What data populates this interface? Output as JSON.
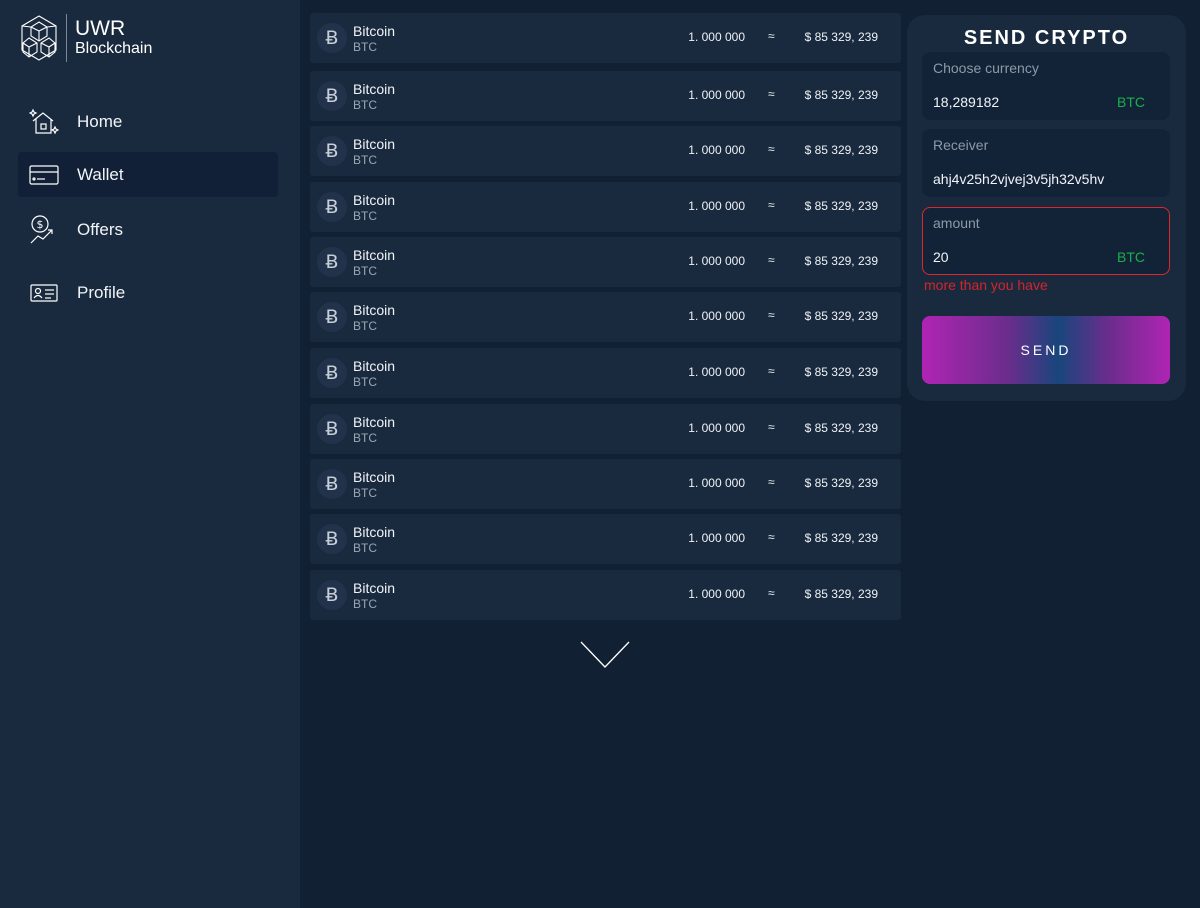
{
  "brand": {
    "line1": "UWR",
    "line2": "Blockchain"
  },
  "nav": [
    {
      "label": "Home",
      "icon": "home-icon",
      "active": false
    },
    {
      "label": "Wallet",
      "icon": "wallet-card-icon",
      "active": true
    },
    {
      "label": "Offers",
      "icon": "dollar-trend-icon",
      "active": false
    },
    {
      "label": "Profile",
      "icon": "id-card-icon",
      "active": false
    }
  ],
  "coins": [
    {
      "icon": "bitcoin-icon",
      "name": "Bitcoin",
      "symbol": "BTC",
      "amount": "1. 000 000",
      "approx": "≈",
      "usd": "$ 85 329, 239"
    },
    {
      "icon": "bitcoin-icon",
      "name": "Bitcoin",
      "symbol": "BTC",
      "amount": "1. 000 000",
      "approx": "≈",
      "usd": "$ 85 329, 239"
    },
    {
      "icon": "bitcoin-icon",
      "name": "Bitcoin",
      "symbol": "BTC",
      "amount": "1. 000 000",
      "approx": "≈",
      "usd": "$ 85 329, 239"
    },
    {
      "icon": "bitcoin-icon",
      "name": "Bitcoin",
      "symbol": "BTC",
      "amount": "1. 000 000",
      "approx": "≈",
      "usd": "$ 85 329, 239"
    },
    {
      "icon": "bitcoin-icon",
      "name": "Bitcoin",
      "symbol": "BTC",
      "amount": "1. 000 000",
      "approx": "≈",
      "usd": "$ 85 329, 239"
    },
    {
      "icon": "bitcoin-icon",
      "name": "Bitcoin",
      "symbol": "BTC",
      "amount": "1. 000 000",
      "approx": "≈",
      "usd": "$ 85 329, 239"
    },
    {
      "icon": "bitcoin-icon",
      "name": "Bitcoin",
      "symbol": "BTC",
      "amount": "1. 000 000",
      "approx": "≈",
      "usd": "$ 85 329, 239"
    },
    {
      "icon": "bitcoin-icon",
      "name": "Bitcoin",
      "symbol": "BTC",
      "amount": "1. 000 000",
      "approx": "≈",
      "usd": "$ 85 329, 239"
    },
    {
      "icon": "bitcoin-icon",
      "name": "Bitcoin",
      "symbol": "BTC",
      "amount": "1. 000 000",
      "approx": "≈",
      "usd": "$ 85 329, 239"
    },
    {
      "icon": "bitcoin-icon",
      "name": "Bitcoin",
      "symbol": "BTC",
      "amount": "1. 000 000",
      "approx": "≈",
      "usd": "$ 85 329, 239"
    },
    {
      "icon": "bitcoin-icon",
      "name": "Bitcoin",
      "symbol": "BTC",
      "amount": "1. 000 000",
      "approx": "≈",
      "usd": "$ 85 329, 239"
    }
  ],
  "send": {
    "title": "SEND CRYPTO",
    "currency": {
      "label": "Choose currency",
      "value": "18,289182",
      "unit": "BTC"
    },
    "receiver": {
      "label": "Receiver",
      "value": "ahj4v25h2vjvej3v5jh32v5hv"
    },
    "amount": {
      "label": "amount",
      "value": "20",
      "unit": "BTC"
    },
    "error": "more than you have",
    "button": "SEND"
  },
  "colors": {
    "page_bg": "#122033",
    "panel_bg": "#1a2a3e",
    "accent_green": "#17b04a",
    "error_red": "#e0262d",
    "button_gradient": [
      "#b024b3",
      "#18467c"
    ]
  }
}
